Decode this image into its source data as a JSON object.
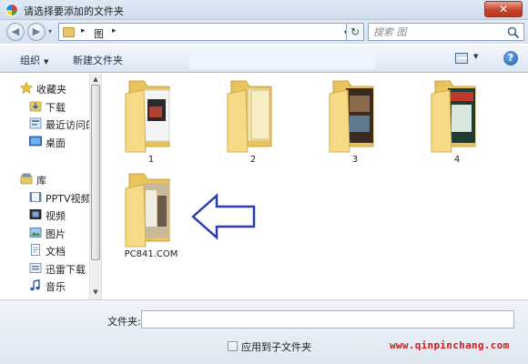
{
  "window": {
    "title": "请选择要添加的文件夹",
    "close_glyph": "✕",
    "app_icon": "media-player-icon"
  },
  "navigation": {
    "back_glyph": "◀",
    "forward_glyph": "▶",
    "history_glyph": "▾",
    "breadcrumb": [
      "图"
    ],
    "crumb_separator": "▸",
    "refresh_glyph": "↻",
    "search_placeholder": "搜索 图"
  },
  "toolbar": {
    "organize_label": "组织",
    "organize_caret": "▼",
    "new_folder_label": "新建文件夹",
    "view_caret": "▼",
    "help_glyph": "?"
  },
  "sidebar": {
    "items": [
      {
        "label": "收藏夹",
        "icon": "star-icon",
        "selected": true
      },
      {
        "label": "下载",
        "icon": "download-folder-icon"
      },
      {
        "label": "最近访问的",
        "icon": "recent-places-icon"
      },
      {
        "label": "桌面",
        "icon": "desktop-icon"
      },
      {
        "label": "库",
        "icon": "library-icon"
      },
      {
        "label": "PPTV视频",
        "icon": "video-library-icon"
      },
      {
        "label": "视频",
        "icon": "video-library-icon"
      },
      {
        "label": "图片",
        "icon": "picture-library-icon"
      },
      {
        "label": "文档",
        "icon": "document-library-icon"
      },
      {
        "label": "迅雷下载",
        "icon": "library-icon"
      },
      {
        "label": "音乐",
        "icon": "music-library-icon"
      }
    ],
    "scroll_up_glyph": "▲",
    "scroll_down_glyph": "▼"
  },
  "files": [
    {
      "name": "1"
    },
    {
      "name": "2"
    },
    {
      "name": "3"
    },
    {
      "name": "4"
    },
    {
      "name": "PC841.COM"
    }
  ],
  "annotation": {
    "arrow_color": "#2b3cb0"
  },
  "footer": {
    "folder_label": "文件夹:",
    "folder_value": "",
    "subfolder_checkbox_label": "应用到子文件夹",
    "subfolder_checked": false,
    "watermark": "www.qinpinchang.com"
  },
  "colors": {
    "folder_fill": "#f5d783",
    "watermark": "#d11a1a"
  }
}
